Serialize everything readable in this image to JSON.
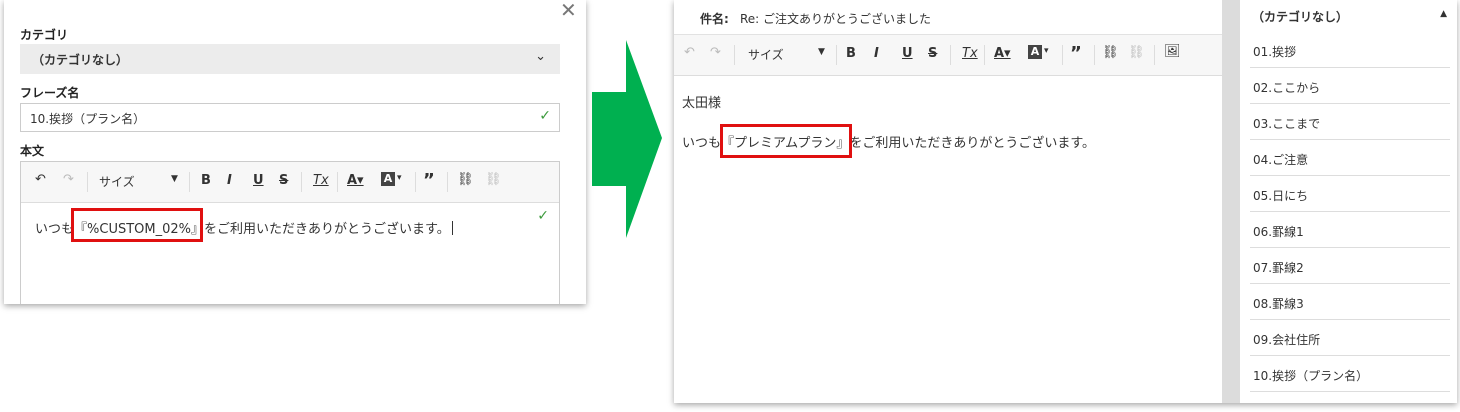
{
  "left": {
    "category_label": "カテゴリ",
    "category_value": "（カテゴリなし）",
    "phrase_label": "フレーズ名",
    "phrase_value": "10.挨拶（プラン名）",
    "body_label": "本文",
    "toolbar": {
      "size_label": "サイズ"
    },
    "body": {
      "prefix": "いつも",
      "highlight": "『%CUSTOM_02%』",
      "suffix": "をご利用いただきありがとうございます。"
    }
  },
  "right": {
    "subject_label": "件名:",
    "subject_value": "Re: ご注文ありがとうございました",
    "toolbar": {
      "size_label": "サイズ"
    },
    "greeting": "太田様",
    "body": {
      "prefix": "いつも",
      "highlight": "『プレミアムプラン』",
      "suffix": "をご利用いただきありがとうございます。"
    },
    "category_header": "（カテゴリなし）",
    "phrases": [
      "01.挨拶",
      "02.ここから",
      "03.ここまで",
      "04.ご注意",
      "05.日にち",
      "06.罫線1",
      "07.罫線2",
      "08.罫線3",
      "09.会社住所",
      "10.挨拶（プラン名）"
    ]
  },
  "colors": {
    "highlight_border": "#e01010",
    "arrow": "#00b050",
    "check": "#3c9a3c"
  }
}
